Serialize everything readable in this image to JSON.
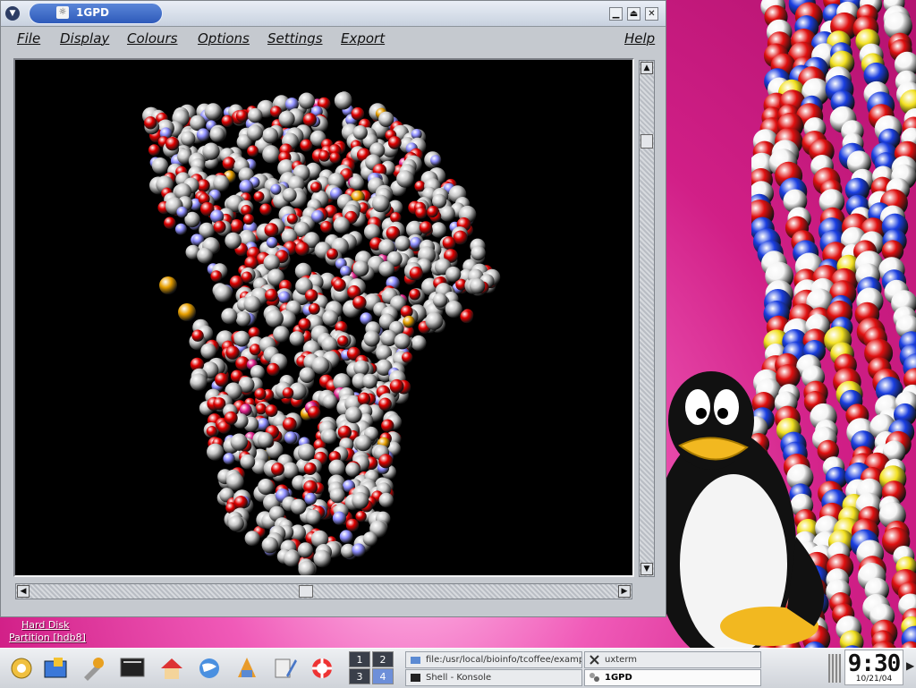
{
  "window": {
    "title": "1GPD",
    "menu": [
      "File",
      "Display",
      "Colours",
      "Options",
      "Settings",
      "Export",
      "Help"
    ]
  },
  "desktop": {
    "icon_label_line1": "Hard Disk",
    "icon_label_line2": "Partition [hdb8]"
  },
  "taskbar": {
    "pager": [
      "1",
      "2",
      "3",
      "4"
    ],
    "active_desktop": "4",
    "tasks": [
      {
        "label": "file:/usr/local/bioinfo/tcoffee/example",
        "icon": "folder-icon"
      },
      {
        "label": "uxterm",
        "icon": "x-icon"
      },
      {
        "label": "Shell - Konsole",
        "icon": "terminal-icon"
      },
      {
        "label": "1GPD",
        "icon": "molecule-icon",
        "active": true
      }
    ],
    "clock_time": "9:30",
    "clock_date": "10/21/04"
  },
  "colors": {
    "desktop_pink": "#d8248f",
    "title_blue": "#2e5aba",
    "atom_carbon": "#c8c8c8",
    "atom_oxygen": "#e00000",
    "atom_nitrogen": "#8f8fff",
    "atom_sulfur": "#e8a000"
  }
}
